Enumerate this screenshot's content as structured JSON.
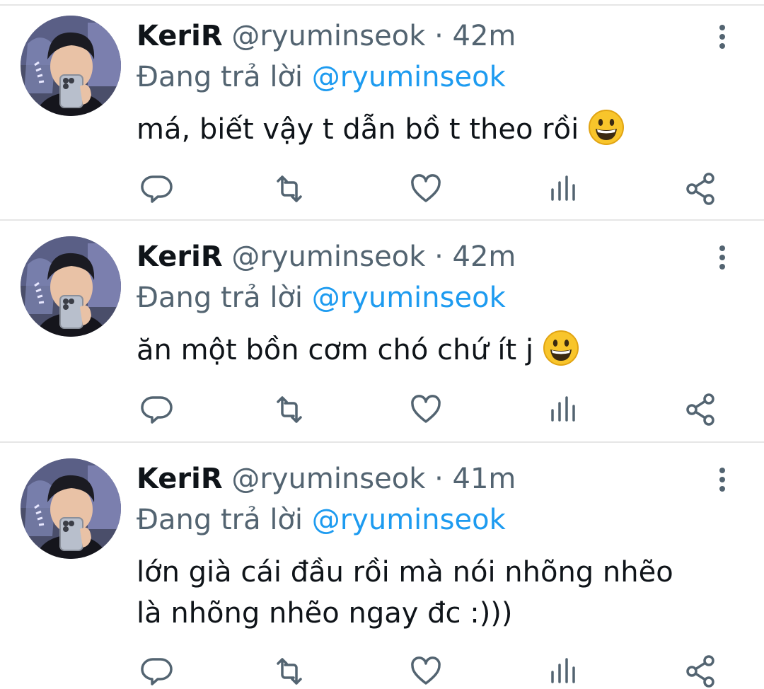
{
  "tweets": [
    {
      "name": "KeriR",
      "handle": "@ryuminseok",
      "separator": "·",
      "time": "42m",
      "reply_prefix": "Đang trả lời",
      "reply_to": "@ryuminseok",
      "text": "má, biết vậy t dẫn bồ t theo rồi",
      "emoji": "grinning-face"
    },
    {
      "name": "KeriR",
      "handle": "@ryuminseok",
      "separator": "·",
      "time": "42m",
      "reply_prefix": "Đang trả lời",
      "reply_to": "@ryuminseok",
      "text": "ăn một bồn cơm chó chứ ít j",
      "emoji": "grinning-face"
    },
    {
      "name": "KeriR",
      "handle": "@ryuminseok",
      "separator": "·",
      "time": "41m",
      "reply_prefix": "Đang trả lời",
      "reply_to": "@ryuminseok",
      "text_line1": "lớn già cái đầu rồi mà nói nhõng nhẽo",
      "text_line2": "là nhõng nhẽo ngay đc :)))"
    }
  ],
  "icons": {
    "reply": "reply-icon",
    "retweet": "retweet-icon",
    "like": "heart-icon",
    "views": "analytics-icon",
    "share": "share-icon",
    "more": "more-vertical-icon"
  },
  "colors": {
    "text": "#0f1419",
    "secondary": "#536471",
    "mention": "#1d9bf0",
    "divider": "#e6e6e6"
  }
}
